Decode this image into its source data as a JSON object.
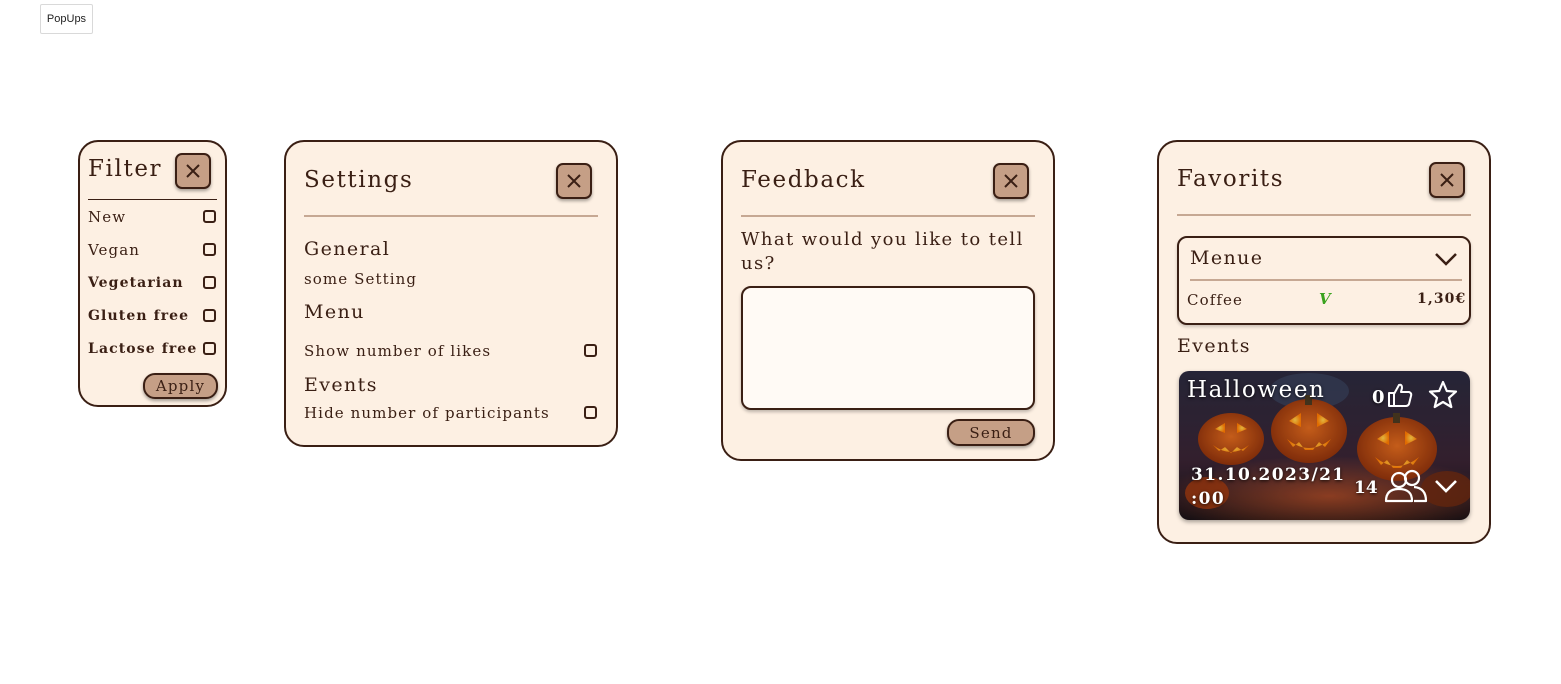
{
  "page_tag": "PopUps",
  "filter": {
    "title": "Filter",
    "options": [
      "New",
      "Vegan",
      "Vegetarian",
      "Gluten free",
      "Lactose free"
    ],
    "apply_label": "Apply"
  },
  "settings": {
    "title": "Settings",
    "general_heading": "General",
    "general_item": "some Setting",
    "menu_heading": "Menu",
    "menu_item": "Show number of likes",
    "events_heading": "Events",
    "events_item": "Hide number of participants"
  },
  "feedback": {
    "title": "Feedback",
    "question": "What would you like to tell us?",
    "input_value": "",
    "send_label": "Send"
  },
  "favorits": {
    "title": "Favorits",
    "menu_card": {
      "title": "Menue",
      "item_name": "Coffee",
      "item_tag": "V",
      "item_price": "1,30€"
    },
    "events_heading": "Events",
    "event": {
      "name": "Halloween",
      "likes": "0",
      "date_line1": "31.10.2023/21",
      "date_line2": ":00",
      "participants": "14"
    }
  },
  "colors": {
    "popup_bg": "#fdf0e3",
    "border": "#3a1f14",
    "button_bg": "#c59f86",
    "vegan_tag": "#3aa21e"
  }
}
